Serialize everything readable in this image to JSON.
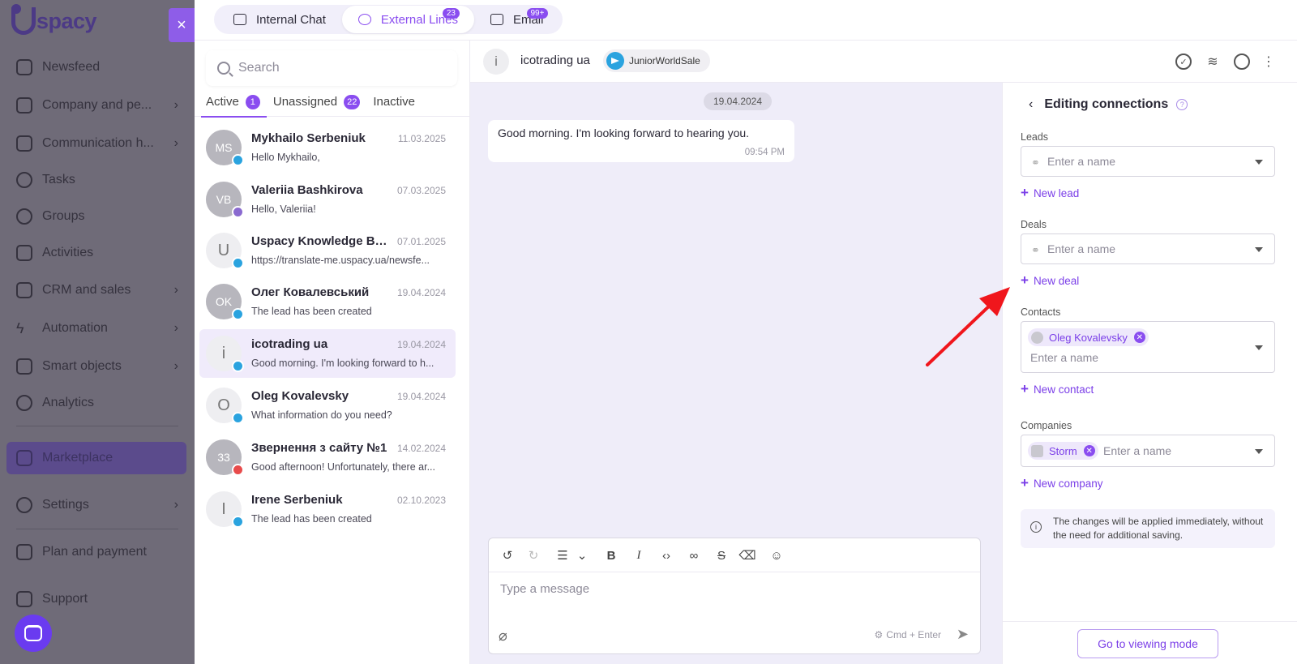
{
  "nav": {
    "logo": "spacy",
    "close": "×",
    "items": [
      {
        "label": "Newsfeed"
      },
      {
        "label": "Company and pe..."
      },
      {
        "label": "Communication h..."
      },
      {
        "label": "Tasks"
      },
      {
        "label": "Groups"
      },
      {
        "label": "Activities"
      },
      {
        "label": "CRM and sales"
      },
      {
        "label": "Automation"
      },
      {
        "label": "Smart objects"
      },
      {
        "label": "Analytics"
      },
      {
        "label": "Marketplace"
      },
      {
        "label": "Settings"
      },
      {
        "label": "Plan and payment"
      },
      {
        "label": "Support"
      }
    ]
  },
  "tabs": [
    {
      "label": "Internal Chat",
      "badge": ""
    },
    {
      "label": "External Lines",
      "badge": "23"
    },
    {
      "label": "Email",
      "badge": "99+"
    }
  ],
  "list": {
    "search_placeholder": "Search",
    "filters": [
      {
        "label": "Active",
        "count": "1"
      },
      {
        "label": "Unassigned",
        "count": "22"
      },
      {
        "label": "Inactive",
        "count": ""
      }
    ],
    "chats": [
      {
        "initials": "MS",
        "name": "Mykhailo Serbeniuk",
        "date": "11.03.2025",
        "preview": "Hello Mykhailo,"
      },
      {
        "initials": "VB",
        "name": "Valeriia Bashkirova",
        "date": "07.03.2025",
        "preview": "Hello, Valeriia!"
      },
      {
        "initials": "U",
        "name": "Uspacy Knowledge Ba...",
        "date": "07.01.2025",
        "preview": "https://translate-me.uspacy.ua/newsfe..."
      },
      {
        "initials": "OK",
        "name": "Олег Ковалевський",
        "date": "19.04.2024",
        "preview": "The lead has been created"
      },
      {
        "initials": "i",
        "name": "icotrading ua",
        "date": "19.04.2024",
        "preview": "Good morning. I'm looking forward to h..."
      },
      {
        "initials": "O",
        "name": "Oleg Kovalevsky",
        "date": "19.04.2024",
        "preview": "What information do you need?"
      },
      {
        "initials": "33",
        "name": "Звернення з сайту №1",
        "date": "14.02.2024",
        "preview": "Good afternoon! Unfortunately, there ar..."
      },
      {
        "initials": "I",
        "name": "Irene Serbeniuk",
        "date": "02.10.2023",
        "preview": "The lead has been created"
      }
    ]
  },
  "conversation": {
    "avatar": "i",
    "name": "icotrading ua",
    "channel": "JuniorWorldSale",
    "date_divider": "19.04.2024",
    "message": {
      "text": "Good morning. I'm looking forward to hearing you.",
      "time": "09:54 PM"
    },
    "composer_placeholder": "Type a message",
    "send_hint": "Cmd + Enter"
  },
  "panel": {
    "title": "Editing connections",
    "leads": {
      "label": "Leads",
      "placeholder": "Enter a name",
      "add": "New lead"
    },
    "deals": {
      "label": "Deals",
      "placeholder": "Enter a name",
      "add": "New deal"
    },
    "contacts": {
      "label": "Contacts",
      "tag": "Oleg Kovalevsky",
      "placeholder": "Enter a name",
      "add": "New contact"
    },
    "companies": {
      "label": "Companies",
      "tag": "Storm",
      "placeholder": "Enter a name",
      "add": "New company"
    },
    "note": "The changes will be applied immediately, without the need for additional saving.",
    "view_button": "Go to viewing mode"
  },
  "colors": {
    "accent": "#8a4df0",
    "telegram": "#2aa3df",
    "annotation": "#f0161c"
  }
}
